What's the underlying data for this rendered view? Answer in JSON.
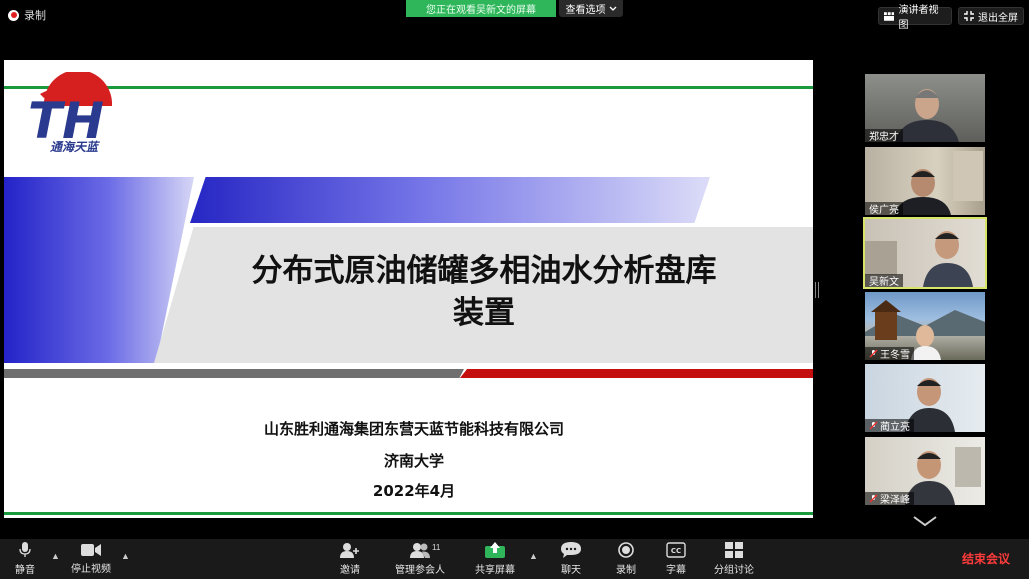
{
  "topbar": {
    "record_label": "录制",
    "share_banner": "您正在观看吴新文的屏幕",
    "view_options": "查看选项",
    "speaker_view": "演讲者视图",
    "exit_fullscreen": "退出全屏"
  },
  "slide": {
    "logo_text": "通海天蓝",
    "title_line1": "分布式原油储罐多相油水分析盘库",
    "title_line2": "装置",
    "company": "山东胜利通海集团东营天蓝节能科技有限公司",
    "university": "济南大学",
    "date": "2022年4月"
  },
  "participants": [
    {
      "name": "郑忠才",
      "muted": false,
      "active": false
    },
    {
      "name": "侯广亮",
      "muted": false,
      "active": false
    },
    {
      "name": "吴新文",
      "muted": false,
      "active": true
    },
    {
      "name": "王冬雪",
      "muted": true,
      "active": false
    },
    {
      "name": "蔺立亮",
      "muted": true,
      "active": false
    },
    {
      "name": "梁泽峰",
      "muted": true,
      "active": false
    }
  ],
  "toolbar": {
    "mute": "静音",
    "stop_video": "停止视频",
    "invite": "邀请",
    "manage_participants": "管理参会人",
    "participant_count": "11",
    "share_screen": "共享屏幕",
    "chat": "聊天",
    "record": "录制",
    "captions": "字幕",
    "cc_icon_text": "CC",
    "breakout": "分组讨论",
    "end_meeting": "结束会议"
  },
  "colors": {
    "share_green": "#2fb55a",
    "active_border": "#d7e46a",
    "end_red": "#ff3b3b",
    "slide_green": "#1a9a3c",
    "slide_red": "#c40f0f"
  }
}
